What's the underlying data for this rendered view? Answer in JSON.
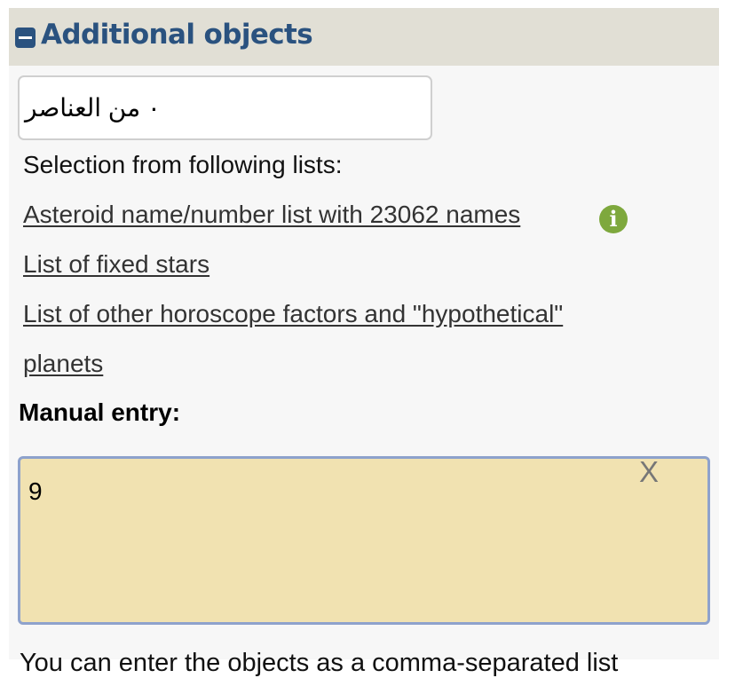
{
  "section": {
    "title": "Additional objects",
    "collapse_icon": "minus-square-icon",
    "accent_color": "#2a527f"
  },
  "object_select": {
    "value": "٠ من العناصر"
  },
  "lists": {
    "intro": "Selection from following lists:",
    "asteroid_link": "Asteroid name/number list with 23062 names",
    "info_icon": "info-circle-icon",
    "info_glyph": "i",
    "fixed_stars_link": "List of fixed stars",
    "other_factors_link_line1": "List of other horoscope factors and \"hypothetical\"",
    "other_factors_link_line2": "planets"
  },
  "manual_entry": {
    "label": "Manual entry:",
    "value": "9",
    "clear_label": "X",
    "background_color": "#f1e2b1"
  },
  "footer": {
    "partial_text": "You can enter the objects as a comma-separated list"
  }
}
